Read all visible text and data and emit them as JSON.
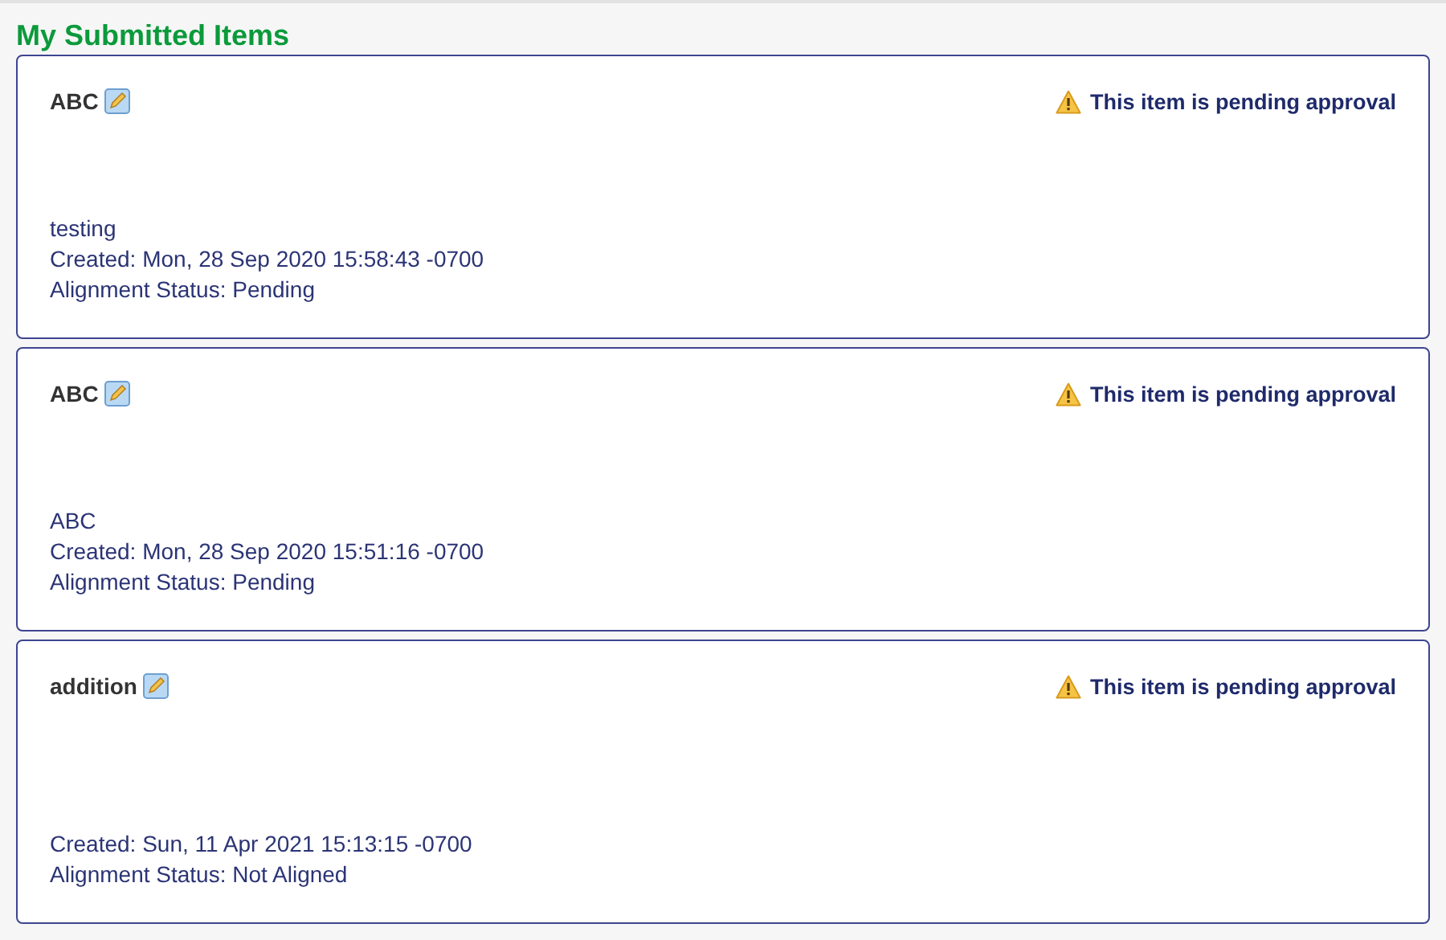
{
  "heading": "My Submitted Items",
  "items": [
    {
      "title": "ABC",
      "status": "This item is pending approval",
      "description": "testing",
      "created": "Created: Mon, 28 Sep 2020 15:58:43 -0700",
      "alignment": "Alignment Status: Pending"
    },
    {
      "title": "ABC",
      "status": "This item is pending approval",
      "description": "ABC",
      "created": "Created: Mon, 28 Sep 2020 15:51:16 -0700",
      "alignment": "Alignment Status: Pending"
    },
    {
      "title": "addition",
      "status": "This item is pending approval",
      "created": "Created: Sun, 11 Apr 2021 15:13:15 -0700",
      "alignment": "Alignment Status: Not Aligned"
    }
  ]
}
